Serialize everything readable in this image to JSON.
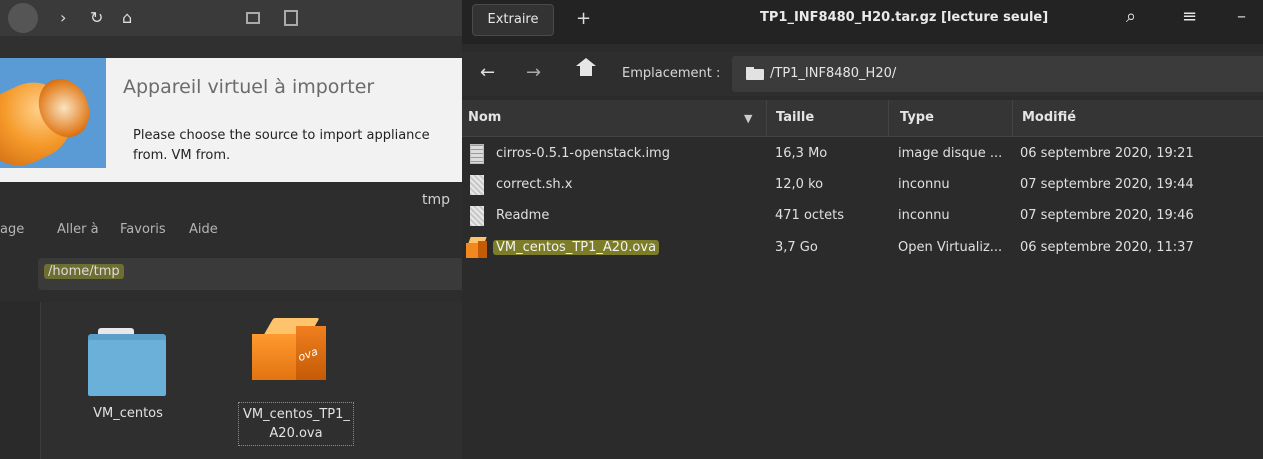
{
  "left": {
    "dialog": {
      "title": "Appareil virtuel à importer",
      "description": "Please choose the source to import appliance from. VM from."
    },
    "file_manager": {
      "title": "tmp",
      "menu": [
        "age",
        "Aller à",
        "Favoris",
        "Aide"
      ],
      "path": "/home/tmp",
      "items": [
        {
          "label": "VM_centos",
          "icon": "folder-icon"
        },
        {
          "label_line1": "VM_centos_TP1_",
          "label_line2": "A20.ova",
          "icon": "ova-package-icon"
        }
      ]
    }
  },
  "archive": {
    "toolbar": {
      "extract_label": "Extraire",
      "add_glyph": "+",
      "window_title": "TP1_INF8480_H20.tar.gz [lecture seule]",
      "search_glyph": "⌕",
      "menu_glyph": "≡",
      "minimize_glyph": "–"
    },
    "navigation": {
      "back_glyph": "←",
      "forward_glyph": "→",
      "location_label": "Emplacement :",
      "location_value": "/TP1_INF8480_H20/"
    },
    "columns": [
      "Nom",
      "Taille",
      "Type",
      "Modifié"
    ],
    "sort_indicator": "▼",
    "rows": [
      {
        "name": "cirros-0.5.1-openstack.img",
        "size": "16,3 Mo",
        "type": "image disque ...",
        "modified": "06 septembre 2020, 19:21",
        "icon": "disk-image-file-icon"
      },
      {
        "name": "correct.sh.x",
        "size": "12,0 ko",
        "type": "inconnu",
        "modified": "07 septembre 2020, 19:44",
        "icon": "unknown-file-icon"
      },
      {
        "name": "Readme",
        "size": "471 octets",
        "type": "inconnu",
        "modified": "07 septembre 2020, 19:46",
        "icon": "unknown-file-icon"
      },
      {
        "name": "VM_centos_TP1_A20.ova",
        "size": "3,7 Go",
        "type": "Open Virtualiz...",
        "modified": "06 septembre 2020, 11:37",
        "icon": "ova-package-icon",
        "highlighted": true
      }
    ]
  },
  "colors": {
    "highlight": "#e1e128",
    "dark_bg": "#2b2b2b",
    "accent_orange": "#f3881f"
  }
}
